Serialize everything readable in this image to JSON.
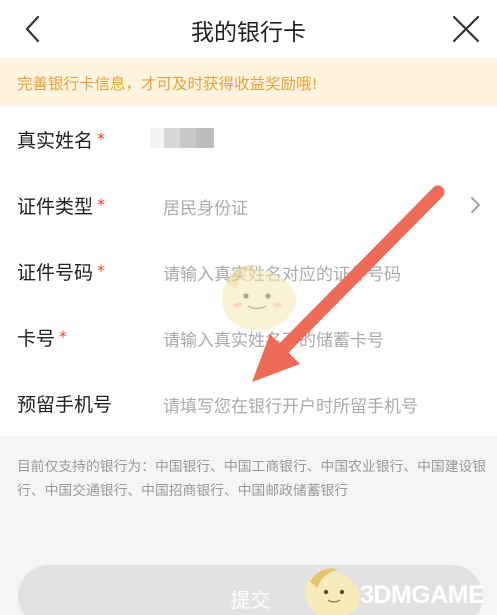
{
  "header": {
    "title": "我的银行卡",
    "back_icon": "chevron-left-icon",
    "close_icon": "close-icon"
  },
  "tip": {
    "text": "完善银行卡信息，才可及时获得收益奖励哦!"
  },
  "form": {
    "required_mark": "*",
    "fields": [
      {
        "label": "真实姓名",
        "required": true,
        "value": "",
        "masked": true
      },
      {
        "label": "证件类型",
        "required": true,
        "value": "居民身份证",
        "has_arrow": true
      },
      {
        "label": "证件号码",
        "required": true,
        "placeholder": "请输入真实姓名对应的证件号码"
      },
      {
        "label": "卡号",
        "required": true,
        "placeholder": "请输入真实姓名下的储蓄卡号"
      },
      {
        "label": "预留手机号",
        "required": false,
        "placeholder": "请填写您在银行开户时所留手机号"
      }
    ]
  },
  "notice": {
    "text": "目前仅支持的银行为：中国银行、中国工商银行、中国农业银行、中国建设银行、中国交通银行、中国招商银行、中国邮政储蓄银行"
  },
  "submit": {
    "label": "提交"
  },
  "annotation": {
    "arrow_color": "#ee6b57"
  },
  "watermark": {
    "text": "3DMGAME"
  },
  "colors": {
    "accent": "#e9a13c",
    "tip_background": "#fdf3df",
    "required": "#e8402f",
    "button_disabled": "#e2e2e2"
  }
}
